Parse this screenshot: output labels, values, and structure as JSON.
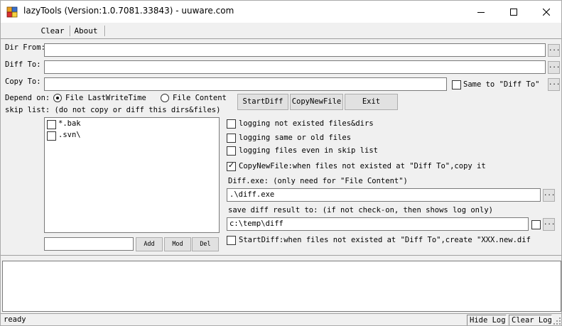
{
  "window": {
    "title": "lazyTools (Version:1.0.7081.33843) - uuware.com",
    "icon": "app-icon",
    "controls": [
      "minimize-icon",
      "maximize-icon",
      "close-icon"
    ]
  },
  "menu": {
    "items": [
      "Clear",
      "About"
    ]
  },
  "paths": {
    "dir_from": {
      "label": "Dir From:",
      "value": ""
    },
    "diff_to": {
      "label": "Diff To:",
      "value": ""
    },
    "copy_to": {
      "label": "Copy To:",
      "value": ""
    },
    "browse_label": "...",
    "same_to_label": "Same to \"Diff To\""
  },
  "depend": {
    "label": "Depend on:",
    "options": [
      "File LastWriteTime",
      "File Content"
    ],
    "selected": "File LastWriteTime"
  },
  "skip": {
    "label": "skip list: (do not copy or diff this dirs&files)",
    "items": [
      {
        "text": "*.bak",
        "checked": false
      },
      {
        "text": ".svn\\",
        "checked": false
      }
    ],
    "input_value": "",
    "add_label": "Add",
    "mod_label": "Mod",
    "del_label": "Del"
  },
  "actions": {
    "start_diff": "StartDiff",
    "copy_new_file": "CopyNewFile",
    "exit": "Exit"
  },
  "options": {
    "log_not_existed": {
      "label": "logging not existed files&dirs",
      "checked": false
    },
    "log_same_old": {
      "label": "logging same or old files",
      "checked": false
    },
    "log_skip": {
      "label": "logging files even in skip list",
      "checked": false
    },
    "copy_new_file": {
      "label": "CopyNewFile:when files not existed at \"Diff To\",copy it",
      "checked": true
    }
  },
  "diff_exe": {
    "label": "Diff.exe: (only need for \"File Content\")",
    "value": ".\\diff.exe"
  },
  "save_diff": {
    "label": "save diff result to: (if not check-on, then shows log only)",
    "value": "c:\\temp\\diff",
    "checked": false
  },
  "start_diff_opt": {
    "label": "StartDiff:when files not existed at \"Diff To\",create \"XXX.new.dif",
    "checked": false
  },
  "log": {
    "text": ""
  },
  "status": {
    "text": "ready",
    "hide_log": "Hide Log",
    "clear_log": "Clear Log"
  }
}
